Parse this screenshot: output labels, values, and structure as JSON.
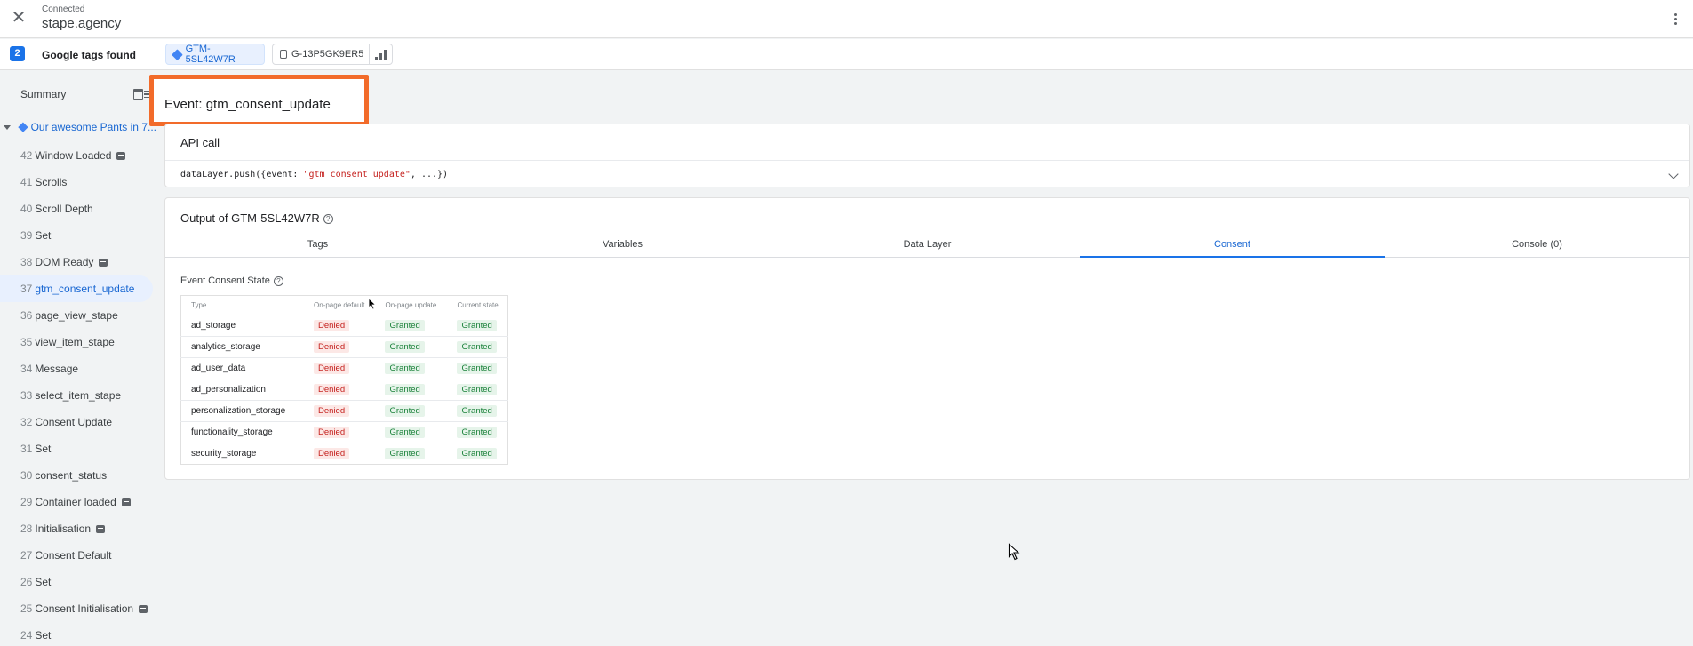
{
  "header": {
    "status_label": "Connected",
    "site": "stape.agency",
    "close_icon": "close-icon",
    "menu_icon": "more-vert-icon"
  },
  "tags_bar": {
    "count": "2",
    "label": "Google tags found",
    "tags": [
      {
        "id": "GTM-5SL42W7R",
        "icon": "gtm-diamond-icon"
      },
      {
        "id": "G-13P5GK9ER5",
        "icon": "lock-icon"
      }
    ]
  },
  "sidebar": {
    "summary_label": "Summary",
    "page_node": "Our awesome Pants in 7...",
    "events": [
      {
        "num": "42",
        "name": "Window Loaded",
        "badge": true,
        "active": false
      },
      {
        "num": "41",
        "name": "Scrolls",
        "badge": false,
        "active": false
      },
      {
        "num": "40",
        "name": "Scroll Depth",
        "badge": false,
        "active": false
      },
      {
        "num": "39",
        "name": "Set",
        "badge": false,
        "active": false
      },
      {
        "num": "38",
        "name": "DOM Ready",
        "badge": true,
        "active": false
      },
      {
        "num": "37",
        "name": "gtm_consent_update",
        "badge": false,
        "active": true
      },
      {
        "num": "36",
        "name": "page_view_stape",
        "badge": false,
        "active": false
      },
      {
        "num": "35",
        "name": "view_item_stape",
        "badge": false,
        "active": false
      },
      {
        "num": "34",
        "name": "Message",
        "badge": false,
        "active": false
      },
      {
        "num": "33",
        "name": "select_item_stape",
        "badge": false,
        "active": false
      },
      {
        "num": "32",
        "name": "Consent Update",
        "badge": false,
        "active": false
      },
      {
        "num": "31",
        "name": "Set",
        "badge": false,
        "active": false
      },
      {
        "num": "30",
        "name": "consent_status",
        "badge": false,
        "active": false
      },
      {
        "num": "29",
        "name": "Container loaded",
        "badge": true,
        "active": false
      },
      {
        "num": "28",
        "name": "Initialisation",
        "badge": true,
        "active": false
      },
      {
        "num": "27",
        "name": "Consent Default",
        "badge": false,
        "active": false
      },
      {
        "num": "26",
        "name": "Set",
        "badge": false,
        "active": false
      },
      {
        "num": "25",
        "name": "Consent Initialisation",
        "badge": true,
        "active": false
      },
      {
        "num": "24",
        "name": "Set",
        "badge": false,
        "active": false
      }
    ]
  },
  "main": {
    "event_title": "Event: gtm_consent_update",
    "api_call": {
      "title": "API call",
      "code_prefix": "dataLayer.push({event: ",
      "code_string": "\"gtm_consent_update\"",
      "code_suffix": ", ...})"
    },
    "output": {
      "title": "Output of GTM-5SL42W7R",
      "tabs": [
        "Tags",
        "Variables",
        "Data Layer",
        "Consent",
        "Console (0)"
      ],
      "active_tab": "Consent",
      "consent_section_title": "Event Consent State",
      "table_headers": [
        "Type",
        "On-page default",
        "On-page update",
        "Current state"
      ],
      "rows": [
        {
          "type": "ad_storage",
          "default": "Denied",
          "update": "Granted",
          "current": "Granted"
        },
        {
          "type": "analytics_storage",
          "default": "Denied",
          "update": "Granted",
          "current": "Granted"
        },
        {
          "type": "ad_user_data",
          "default": "Denied",
          "update": "Granted",
          "current": "Granted"
        },
        {
          "type": "ad_personalization",
          "default": "Denied",
          "update": "Granted",
          "current": "Granted"
        },
        {
          "type": "personalization_storage",
          "default": "Denied",
          "update": "Granted",
          "current": "Granted"
        },
        {
          "type": "functionality_storage",
          "default": "Denied",
          "update": "Granted",
          "current": "Granted"
        },
        {
          "type": "security_storage",
          "default": "Denied",
          "update": "Granted",
          "current": "Granted"
        }
      ]
    }
  },
  "colors": {
    "accent": "#1a73e8",
    "highlight_border": "#f26b2a",
    "denied_bg": "#fce8e6",
    "granted_bg": "#e6f4ea"
  }
}
